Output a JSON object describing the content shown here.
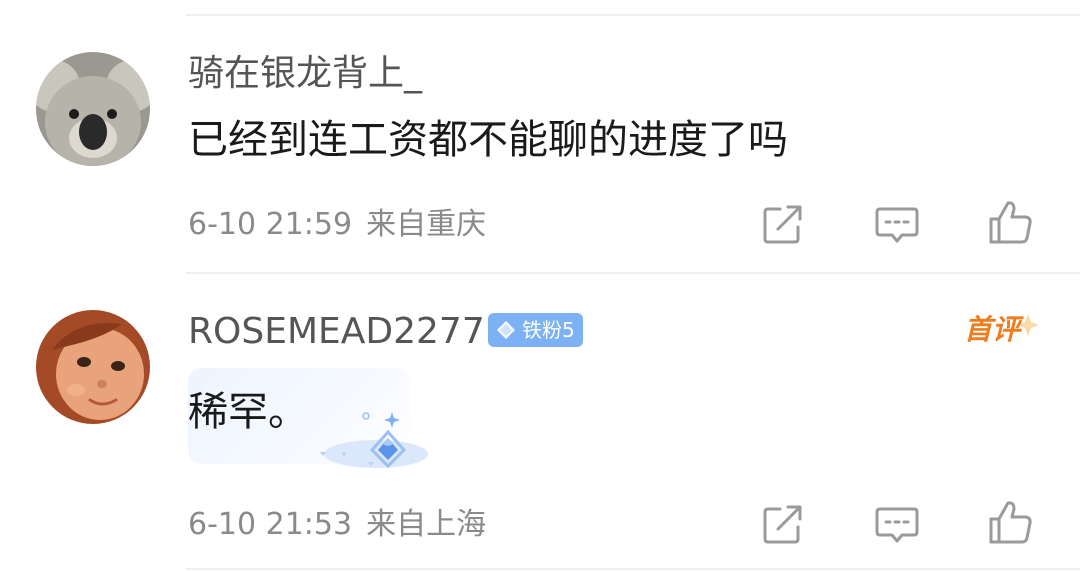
{
  "comments": [
    {
      "avatar_icon": "koala-avatar-icon",
      "username": "骑在银龙背上_",
      "text": "已经到连工资都不能聊的进度了吗",
      "time": "6-10 21:59",
      "location": "来自重庆"
    },
    {
      "avatar_icon": "baby-avatar-icon",
      "username": "ROSEMEAD2277",
      "badge": "铁粉5",
      "first_tag": "首评",
      "text": "稀罕。",
      "time": "6-10 21:53",
      "location": "来自上海"
    }
  ],
  "actions": {
    "share_icon": "share-icon",
    "reply_icon": "comment-icon",
    "like_icon": "thumbs-up-icon"
  },
  "colors": {
    "badge": "#7cb2f5",
    "first_tag": "#ee7d1f",
    "meta_text": "#8a8a8a"
  }
}
